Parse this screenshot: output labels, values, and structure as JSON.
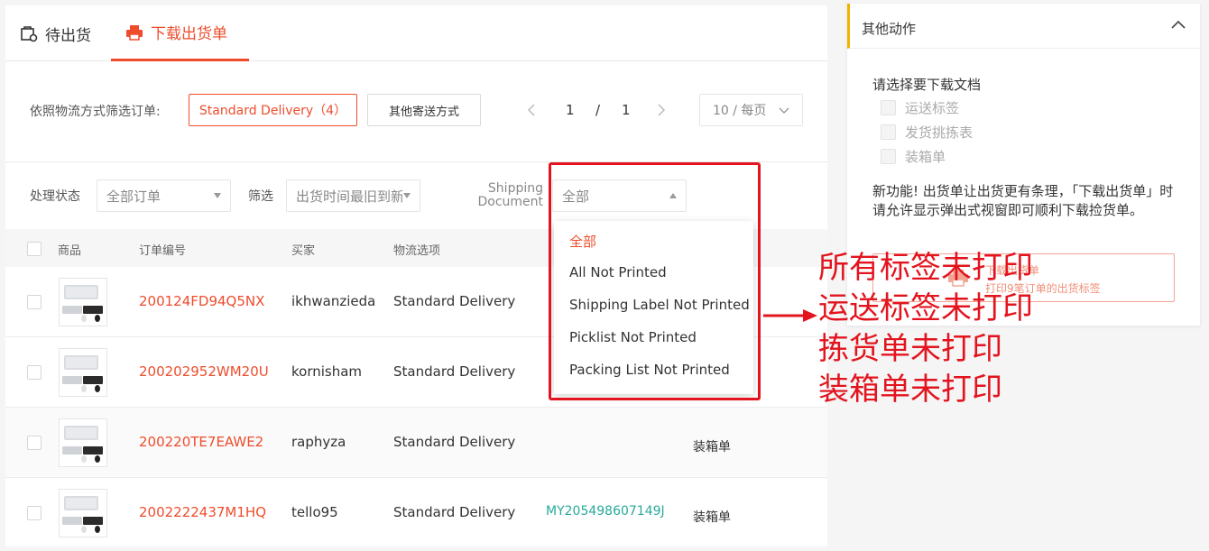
{
  "tabs": {
    "to_ship": "待出货",
    "download": "下载出货单"
  },
  "logistics_filter": {
    "label": "依照物流方式筛选订单:",
    "standard_button": "Standard Delivery（4）",
    "other_button": "其他寄送方式"
  },
  "pagination": {
    "prev": "‹",
    "current": "1",
    "separator": "/",
    "total": "1",
    "next": "›",
    "per_page": "10 / 每页"
  },
  "status_filter": {
    "label": "处理状态",
    "value": "全部订单",
    "filter_label": "筛选",
    "filter_value": "出货时间最旧到新",
    "doc_label_line1": "Shipping",
    "doc_label_line2": "Document",
    "doc_value": "全部"
  },
  "table": {
    "headers": {
      "product": "商品",
      "order_id": "订单编号",
      "buyer": "买家",
      "logistics": "物流选项"
    },
    "rows": [
      {
        "order_id": "200124FD94Q5NX",
        "buyer": "ikhwanzieda",
        "logistics": "Standard Delivery",
        "tracking": "",
        "doc": ""
      },
      {
        "order_id": "200202952WM20U",
        "buyer": "kornisham",
        "logistics": "Standard Delivery",
        "tracking": "",
        "doc": ""
      },
      {
        "order_id": "200220TE7EAWE2",
        "buyer": "raphyza",
        "logistics": "Standard Delivery",
        "tracking": "",
        "doc": "装箱单"
      },
      {
        "order_id": "2002222437M1HQ",
        "buyer": "tello95",
        "logistics": "Standard Delivery",
        "tracking": "MY205498607149J",
        "doc": "装箱单"
      }
    ]
  },
  "dropdown": {
    "items": [
      "全部",
      "All Not Printed",
      "Shipping Label Not Printed",
      "Picklist Not Printed",
      "Packing List Not Printed"
    ]
  },
  "side_panel": {
    "title": "其他动作",
    "subtitle": "请选择要下载文档",
    "options": [
      "运送标签",
      "发货挑拣表",
      "装箱单"
    ],
    "note": "新功能! 出货单让出货更有条理，「下载出货单」时请允许显示弹出式视窗即可顺利下载捡货单。",
    "download_line1": "下载出货单",
    "download_line2": "打印9笔订单的出货标签"
  },
  "annotation": {
    "lines": [
      "所有标签未打印",
      "运送标签未打印",
      "拣货单未打印",
      "装箱单未打印"
    ],
    "color": "#e3141e"
  },
  "colors": {
    "accent": "#ee4d2d",
    "tracking": "#26aa99",
    "side_accent": "#f0b400"
  }
}
